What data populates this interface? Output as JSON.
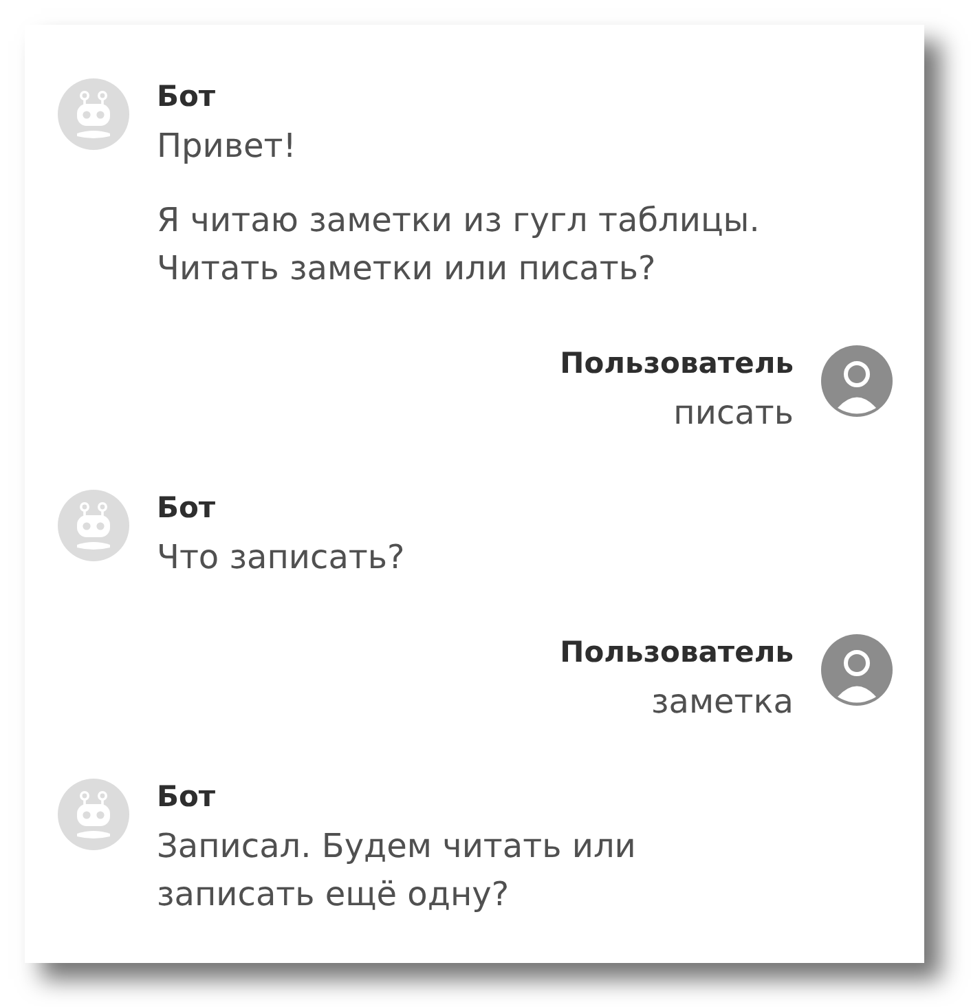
{
  "messages": [
    {
      "kind": "bot",
      "author": "Бот",
      "paragraphs": [
        "Привет!",
        "Я читаю заметки из гугл таблицы. Читать заметки или писать?"
      ]
    },
    {
      "kind": "user",
      "author": "Пользователь",
      "paragraphs": [
        "писать"
      ]
    },
    {
      "kind": "bot",
      "author": "Бот",
      "paragraphs": [
        "Что записать?"
      ]
    },
    {
      "kind": "user",
      "author": "Пользователь",
      "paragraphs": [
        "заметка"
      ]
    },
    {
      "kind": "bot",
      "author": "Бот",
      "paragraphs": [
        "Записал. Будем читать или записать ещё одну?"
      ]
    }
  ]
}
